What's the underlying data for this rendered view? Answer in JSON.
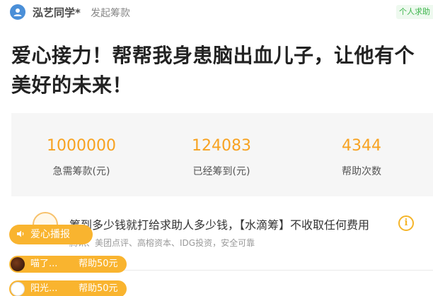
{
  "header": {
    "org_name": "泓艺同学*",
    "org_action": "发起筹款",
    "tag": "个人求助"
  },
  "title": "爱心接力！帮帮我身患脑出血儿子，让他有个美好的未来！",
  "stats": [
    {
      "value": "1000000",
      "label": "急需筹款(元)"
    },
    {
      "value": "124083",
      "label": "已经筹到(元)"
    },
    {
      "value": "4344",
      "label": "帮助次数"
    }
  ],
  "notice": {
    "text": "筹到多少钱就打给求助人多少钱，【水滴筹】不收取任何费用",
    "sub": "腾讯、美团点评、高榕资本、IDG投资，安全可靠"
  },
  "broadcast": {
    "label": "爱心播报"
  },
  "donors": [
    {
      "name": "喵了...",
      "amount": "帮助50元"
    },
    {
      "name": "阳光...",
      "amount": "帮助50元"
    }
  ],
  "colors": {
    "accent": "#f7a221",
    "badge": "#f9b42f",
    "tag_green": "#3bb54a"
  }
}
